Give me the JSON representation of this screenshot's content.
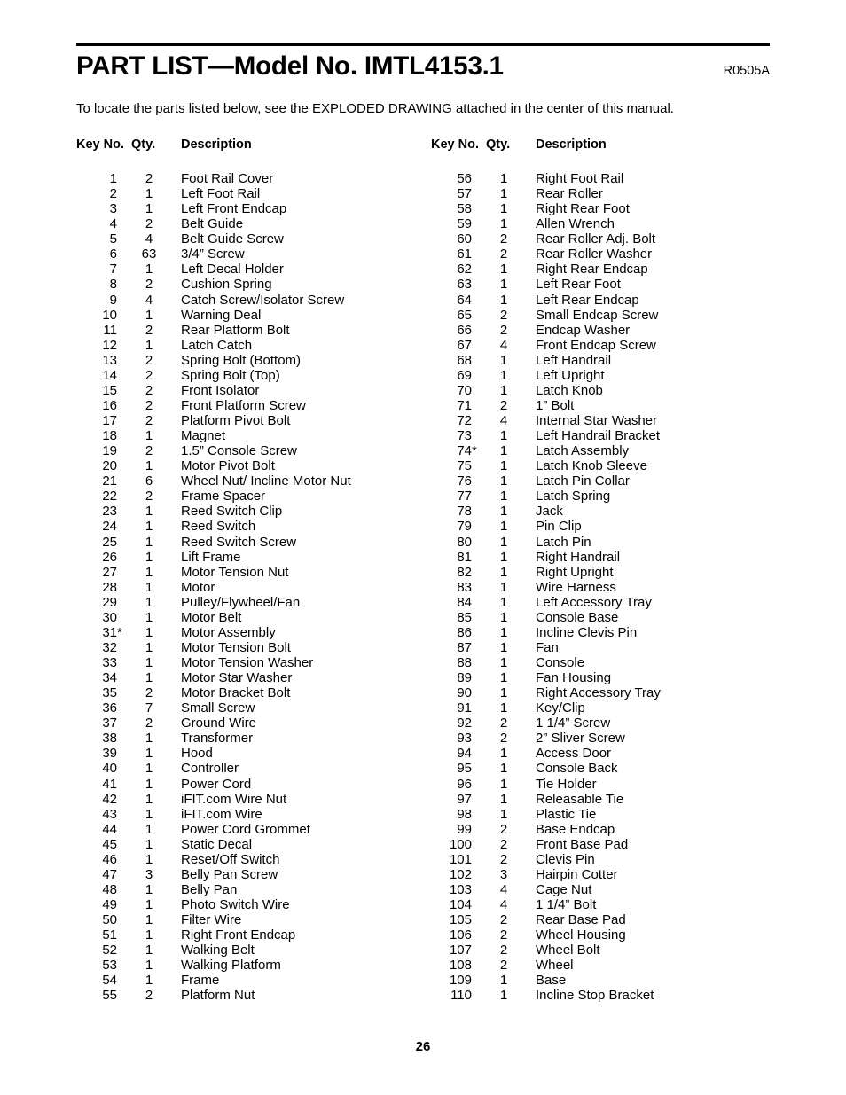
{
  "document": {
    "title": "PART LIST—Model No. IMTL4153.1",
    "revision": "R0505A",
    "intro": "To locate the parts listed below, see the EXPLODED DRAWING attached in the center of this manual.",
    "page_number": "26"
  },
  "table": {
    "headers": {
      "key_no": "Key No.",
      "qty": "Qty.",
      "description": "Description"
    },
    "left_column": [
      {
        "key": "1",
        "qty": "2",
        "desc": "Foot Rail Cover"
      },
      {
        "key": "2",
        "qty": "1",
        "desc": "Left Foot Rail"
      },
      {
        "key": "3",
        "qty": "1",
        "desc": "Left Front Endcap"
      },
      {
        "key": "4",
        "qty": "2",
        "desc": "Belt Guide"
      },
      {
        "key": "5",
        "qty": "4",
        "desc": "Belt Guide Screw"
      },
      {
        "key": "6",
        "qty": "63",
        "desc": "3/4” Screw"
      },
      {
        "key": "7",
        "qty": "1",
        "desc": "Left Decal Holder"
      },
      {
        "key": "8",
        "qty": "2",
        "desc": "Cushion Spring"
      },
      {
        "key": "9",
        "qty": "4",
        "desc": "Catch Screw/Isolator Screw"
      },
      {
        "key": "10",
        "qty": "1",
        "desc": "Warning Deal"
      },
      {
        "key": "11",
        "qty": "2",
        "desc": "Rear Platform Bolt"
      },
      {
        "key": "12",
        "qty": "1",
        "desc": "Latch Catch"
      },
      {
        "key": "13",
        "qty": "2",
        "desc": "Spring Bolt (Bottom)"
      },
      {
        "key": "14",
        "qty": "2",
        "desc": "Spring Bolt (Top)"
      },
      {
        "key": "15",
        "qty": "2",
        "desc": "Front Isolator"
      },
      {
        "key": "16",
        "qty": "2",
        "desc": "Front Platform Screw"
      },
      {
        "key": "17",
        "qty": "2",
        "desc": "Platform Pivot Bolt"
      },
      {
        "key": "18",
        "qty": "1",
        "desc": "Magnet"
      },
      {
        "key": "19",
        "qty": "2",
        "desc": "1.5” Console Screw"
      },
      {
        "key": "20",
        "qty": "1",
        "desc": "Motor Pivot Bolt"
      },
      {
        "key": "21",
        "qty": "6",
        "desc": "Wheel Nut/ Incline Motor Nut"
      },
      {
        "key": "22",
        "qty": "2",
        "desc": "Frame Spacer"
      },
      {
        "key": "23",
        "qty": "1",
        "desc": "Reed Switch Clip"
      },
      {
        "key": "24",
        "qty": "1",
        "desc": "Reed Switch"
      },
      {
        "key": "25",
        "qty": "1",
        "desc": "Reed Switch Screw"
      },
      {
        "key": "26",
        "qty": "1",
        "desc": "Lift Frame"
      },
      {
        "key": "27",
        "qty": "1",
        "desc": "Motor Tension Nut"
      },
      {
        "key": "28",
        "qty": "1",
        "desc": "Motor"
      },
      {
        "key": "29",
        "qty": "1",
        "desc": "Pulley/Flywheel/Fan"
      },
      {
        "key": "30",
        "qty": "1",
        "desc": "Motor Belt"
      },
      {
        "key": "31",
        "star": "*",
        "qty": "1",
        "desc": "Motor Assembly"
      },
      {
        "key": "32",
        "qty": "1",
        "desc": "Motor Tension Bolt"
      },
      {
        "key": "33",
        "qty": "1",
        "desc": "Motor Tension Washer"
      },
      {
        "key": "34",
        "qty": "1",
        "desc": "Motor Star Washer"
      },
      {
        "key": "35",
        "qty": "2",
        "desc": "Motor Bracket Bolt"
      },
      {
        "key": "36",
        "qty": "7",
        "desc": "Small Screw"
      },
      {
        "key": "37",
        "qty": "2",
        "desc": "Ground Wire"
      },
      {
        "key": "38",
        "qty": "1",
        "desc": "Transformer"
      },
      {
        "key": "39",
        "qty": "1",
        "desc": "Hood"
      },
      {
        "key": "40",
        "qty": "1",
        "desc": "Controller"
      },
      {
        "key": "41",
        "qty": "1",
        "desc": "Power Cord"
      },
      {
        "key": "42",
        "qty": "1",
        "desc": "iFIT.com Wire Nut"
      },
      {
        "key": "43",
        "qty": "1",
        "desc": "iFIT.com Wire"
      },
      {
        "key": "44",
        "qty": "1",
        "desc": "Power Cord Grommet"
      },
      {
        "key": "45",
        "qty": "1",
        "desc": "Static Decal"
      },
      {
        "key": "46",
        "qty": "1",
        "desc": "Reset/Off Switch"
      },
      {
        "key": "47",
        "qty": "3",
        "desc": "Belly Pan Screw"
      },
      {
        "key": "48",
        "qty": "1",
        "desc": "Belly Pan"
      },
      {
        "key": "49",
        "qty": "1",
        "desc": "Photo Switch Wire"
      },
      {
        "key": "50",
        "qty": "1",
        "desc": "Filter Wire"
      },
      {
        "key": "51",
        "qty": "1",
        "desc": "Right Front Endcap"
      },
      {
        "key": "52",
        "qty": "1",
        "desc": "Walking Belt"
      },
      {
        "key": "53",
        "qty": "1",
        "desc": "Walking Platform"
      },
      {
        "key": "54",
        "qty": "1",
        "desc": "Frame"
      },
      {
        "key": "55",
        "qty": "2",
        "desc": "Platform Nut"
      }
    ],
    "right_column": [
      {
        "key": "56",
        "qty": "1",
        "desc": "Right Foot Rail"
      },
      {
        "key": "57",
        "qty": "1",
        "desc": "Rear Roller"
      },
      {
        "key": "58",
        "qty": "1",
        "desc": "Right Rear Foot"
      },
      {
        "key": "59",
        "qty": "1",
        "desc": "Allen Wrench"
      },
      {
        "key": "60",
        "qty": "2",
        "desc": "Rear Roller Adj. Bolt"
      },
      {
        "key": "61",
        "qty": "2",
        "desc": "Rear Roller Washer"
      },
      {
        "key": "62",
        "qty": "1",
        "desc": "Right Rear Endcap"
      },
      {
        "key": "63",
        "qty": "1",
        "desc": "Left Rear Foot"
      },
      {
        "key": "64",
        "qty": "1",
        "desc": "Left Rear Endcap"
      },
      {
        "key": "65",
        "qty": "2",
        "desc": "Small Endcap Screw"
      },
      {
        "key": "66",
        "qty": "2",
        "desc": "Endcap Washer"
      },
      {
        "key": "67",
        "qty": "4",
        "desc": "Front Endcap Screw"
      },
      {
        "key": "68",
        "qty": "1",
        "desc": "Left Handrail"
      },
      {
        "key": "69",
        "qty": "1",
        "desc": "Left Upright"
      },
      {
        "key": "70",
        "qty": "1",
        "desc": "Latch Knob"
      },
      {
        "key": "71",
        "qty": "2",
        "desc": "1” Bolt"
      },
      {
        "key": "72",
        "qty": "4",
        "desc": "Internal Star Washer"
      },
      {
        "key": "73",
        "qty": "1",
        "desc": "Left Handrail Bracket"
      },
      {
        "key": "74",
        "star": "*",
        "qty": "1",
        "desc": "Latch Assembly"
      },
      {
        "key": "75",
        "qty": "1",
        "desc": "Latch Knob Sleeve"
      },
      {
        "key": "76",
        "qty": "1",
        "desc": "Latch Pin Collar"
      },
      {
        "key": "77",
        "qty": "1",
        "desc": "Latch Spring"
      },
      {
        "key": "78",
        "qty": "1",
        "desc": "Jack"
      },
      {
        "key": "79",
        "qty": "1",
        "desc": "Pin Clip"
      },
      {
        "key": "80",
        "qty": "1",
        "desc": "Latch Pin"
      },
      {
        "key": "81",
        "qty": "1",
        "desc": "Right Handrail"
      },
      {
        "key": "82",
        "qty": "1",
        "desc": "Right Upright"
      },
      {
        "key": "83",
        "qty": "1",
        "desc": "Wire Harness"
      },
      {
        "key": "84",
        "qty": "1",
        "desc": "Left Accessory Tray"
      },
      {
        "key": "85",
        "qty": "1",
        "desc": "Console Base"
      },
      {
        "key": "86",
        "qty": "1",
        "desc": "Incline Clevis Pin"
      },
      {
        "key": "87",
        "qty": "1",
        "desc": "Fan"
      },
      {
        "key": "88",
        "qty": "1",
        "desc": "Console"
      },
      {
        "key": "89",
        "qty": "1",
        "desc": "Fan Housing"
      },
      {
        "key": "90",
        "qty": "1",
        "desc": "Right Accessory Tray"
      },
      {
        "key": "91",
        "qty": "1",
        "desc": "Key/Clip"
      },
      {
        "key": "92",
        "qty": "2",
        "desc": "1 1/4” Screw"
      },
      {
        "key": "93",
        "qty": "2",
        "desc": "2” Sliver Screw"
      },
      {
        "key": "94",
        "qty": "1",
        "desc": "Access Door"
      },
      {
        "key": "95",
        "qty": "1",
        "desc": "Console Back"
      },
      {
        "key": "96",
        "qty": "1",
        "desc": "Tie Holder"
      },
      {
        "key": "97",
        "qty": "1",
        "desc": "Releasable Tie"
      },
      {
        "key": "98",
        "qty": "1",
        "desc": "Plastic Tie"
      },
      {
        "key": "99",
        "qty": "2",
        "desc": "Base Endcap"
      },
      {
        "key": "100",
        "qty": "2",
        "desc": "Front Base Pad"
      },
      {
        "key": "101",
        "qty": "2",
        "desc": "Clevis Pin"
      },
      {
        "key": "102",
        "qty": "3",
        "desc": "Hairpin Cotter"
      },
      {
        "key": "103",
        "qty": "4",
        "desc": "Cage Nut"
      },
      {
        "key": "104",
        "qty": "4",
        "desc": "1 1/4” Bolt"
      },
      {
        "key": "105",
        "qty": "2",
        "desc": "Rear Base Pad"
      },
      {
        "key": "106",
        "qty": "2",
        "desc": "Wheel Housing"
      },
      {
        "key": "107",
        "qty": "2",
        "desc": "Wheel Bolt"
      },
      {
        "key": "108",
        "qty": "2",
        "desc": "Wheel"
      },
      {
        "key": "109",
        "qty": "1",
        "desc": "Base"
      },
      {
        "key": "110",
        "qty": "1",
        "desc": "Incline Stop Bracket"
      }
    ]
  }
}
